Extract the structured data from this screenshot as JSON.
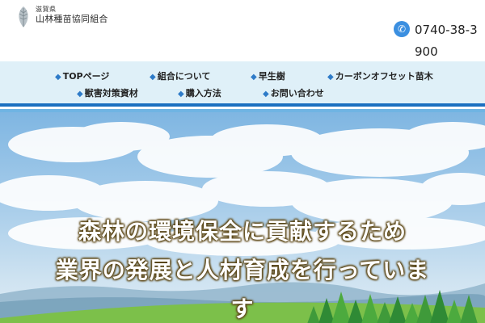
{
  "header": {
    "logo_small": "滋賀県",
    "logo_main": "山林種苗協同組合",
    "phone": "0740-38-3900",
    "phone_icon": "phone-icon"
  },
  "nav": {
    "items": [
      {
        "label": "TOPページ"
      },
      {
        "label": "組合について"
      },
      {
        "label": "早生樹"
      },
      {
        "label": "カーボンオフセット苗木"
      },
      {
        "label": "獣害対策資材"
      },
      {
        "label": "購入方法"
      },
      {
        "label": "お問い合わせ"
      }
    ],
    "bullet": "◆"
  },
  "hero": {
    "line1": "森林の環境保全に貢献するため",
    "line2": "業界の発展と人材育成を行っていま",
    "line3": "す"
  },
  "colors": {
    "nav_bg": "#dff0f8",
    "accent_blue": "#1a6fc0",
    "phone_icon": "#3b8fe0"
  }
}
